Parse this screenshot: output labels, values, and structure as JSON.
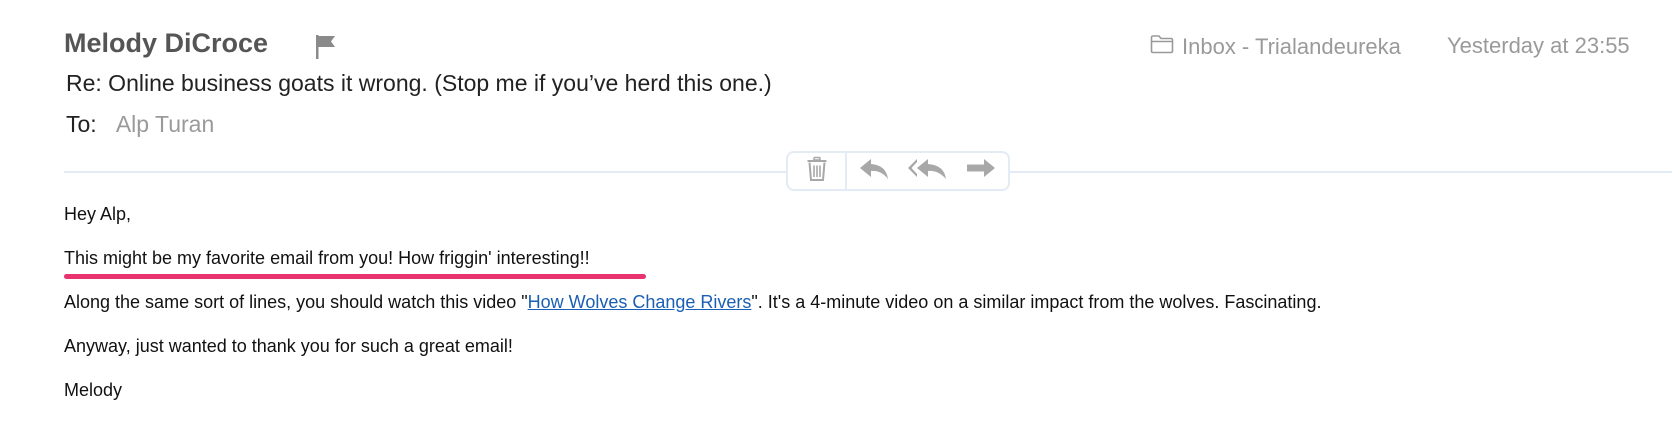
{
  "header": {
    "sender": "Melody DiCroce",
    "mailbox": "Inbox - Trialandeureka",
    "timestamp": "Yesterday at 23:55",
    "subject": "Re: Online business goats it wrong. (Stop me if you’ve herd this one.)",
    "to_label": "To:",
    "to_value": "Alp Turan"
  },
  "icons": {
    "flag": "flag-icon",
    "mailbox": "folder-icon",
    "trash": "trash-icon",
    "reply": "reply-icon",
    "reply_all": "reply-all-icon",
    "forward": "forward-icon"
  },
  "body": {
    "greeting": "Hey Alp,",
    "highlighted_line": "This might be my favorite email from you! How friggin' interesting!!",
    "line3_before": "Along the same sort of lines, you should watch this video \"",
    "link_text": "How Wolves Change Rivers",
    "line3_after": "\". It's a 4-minute video on a similar impact from the wolves. Fascinating.",
    "line4": "Anyway, just wanted to thank you for such a great email!",
    "signature": "Melody"
  },
  "colors": {
    "highlight_underline": "#e8336e",
    "link": "#1a5fb4",
    "muted_text": "#9a9a9a",
    "divider": "#e3ebf4"
  }
}
